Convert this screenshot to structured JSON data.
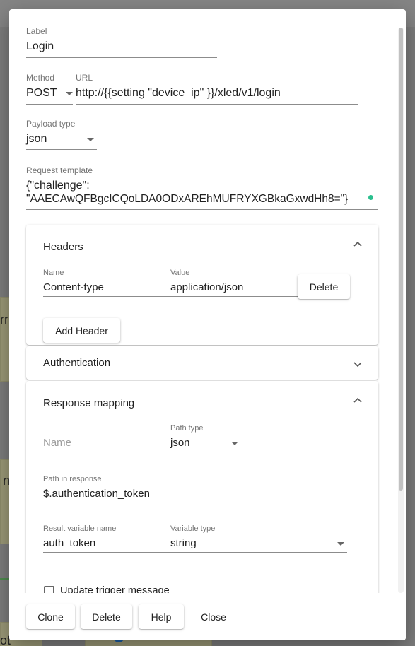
{
  "form": {
    "label": {
      "label": "Label",
      "value": "Login"
    },
    "method": {
      "label": "Method",
      "value": "POST"
    },
    "url": {
      "label": "URL",
      "value": "http://{{setting \"device_ip\" }}/xled/v1/login"
    },
    "payload_type": {
      "label": "Payload type",
      "value": "json"
    },
    "request_template": {
      "label": "Request template",
      "line1": "{\"challenge\":",
      "line2": "\"AAECAwQFBgcICQoLDA0ODxAREhMUFRYXGBkaGxwdHh8=\"}"
    }
  },
  "headers_panel": {
    "title": "Headers",
    "rows": [
      {
        "name_label": "Name",
        "name": "Content-type",
        "value_label": "Value",
        "value": "application/json",
        "delete_label": "Delete"
      }
    ],
    "add_label": "Add Header"
  },
  "auth_panel": {
    "title": "Authentication"
  },
  "response_panel": {
    "title": "Response mapping",
    "name_placeholder": "Name",
    "path_type_label": "Path type",
    "path_type_value": "json",
    "path_label": "Path in response",
    "path_value": "$.authentication_token",
    "result_var_label": "Result variable name",
    "result_var_value": "auth_token",
    "var_type_label": "Variable type",
    "var_type_value": "string",
    "update_trigger_label": "Update trigger message"
  },
  "footer": {
    "clone": "Clone",
    "delete": "Delete",
    "help": "Help",
    "close": "Close"
  },
  "background": {
    "letters": [
      "rr",
      "n",
      "ot"
    ]
  }
}
